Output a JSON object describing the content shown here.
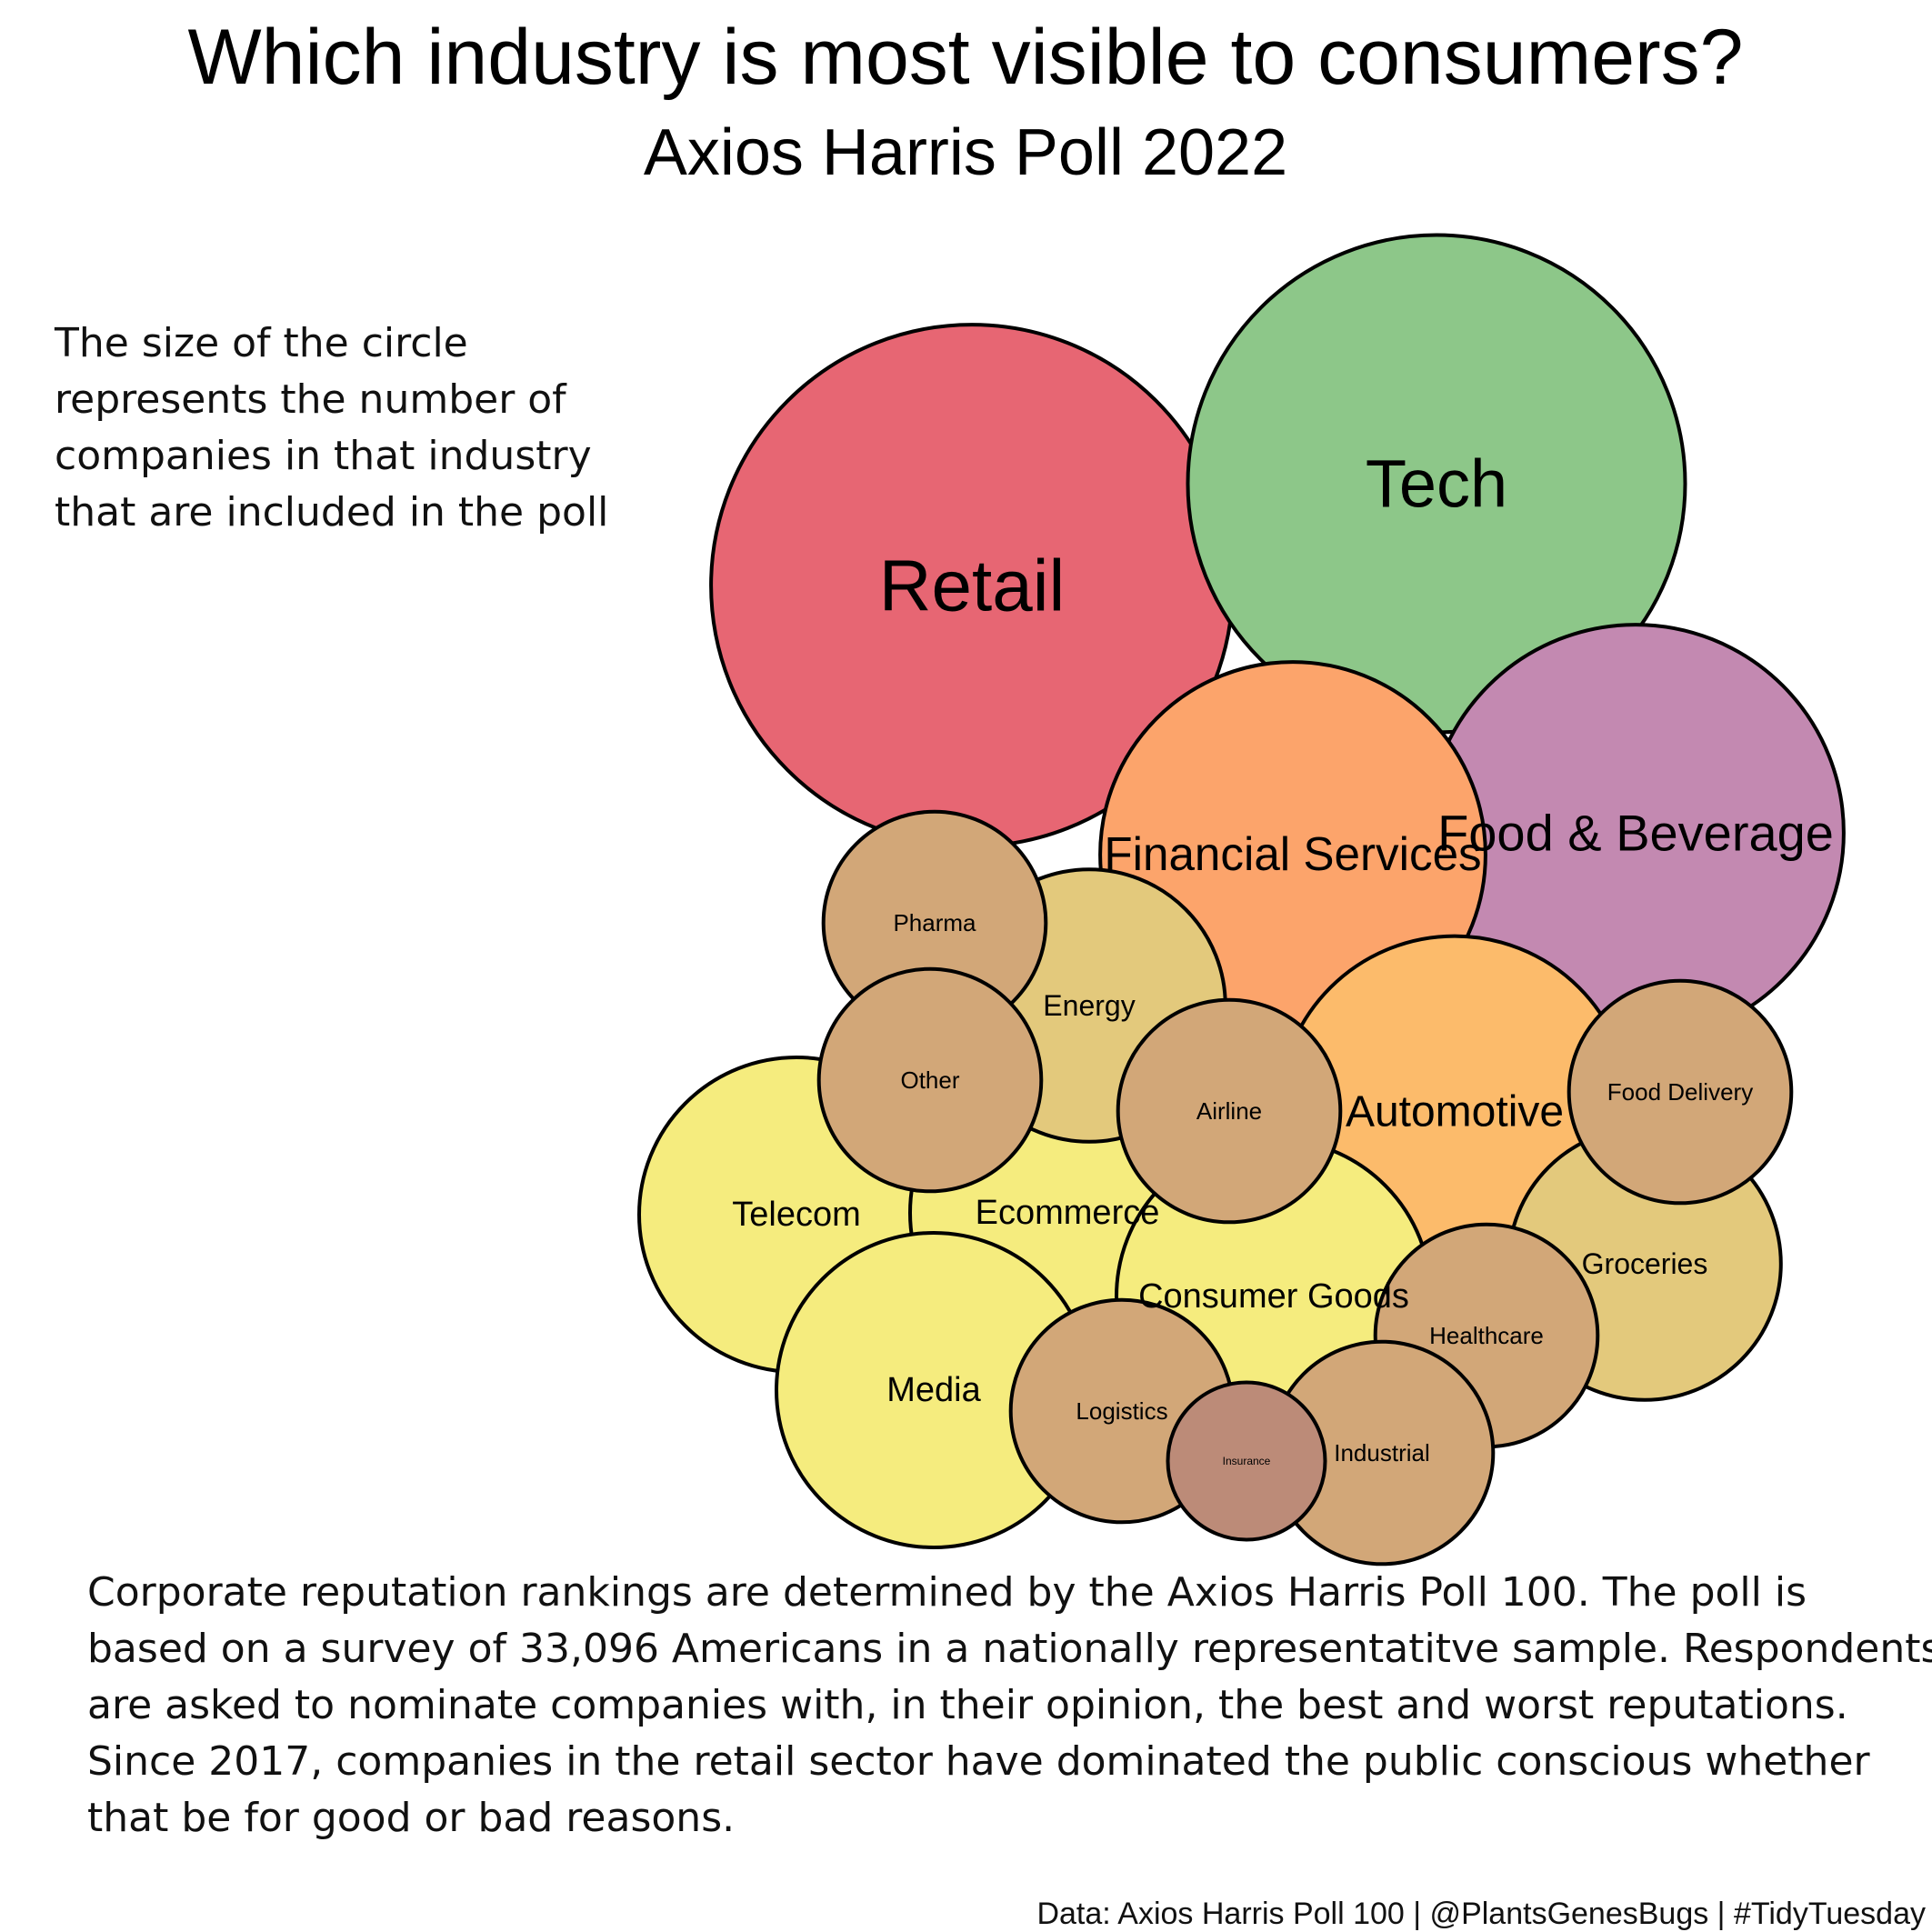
{
  "title": "Which industry is most visible to consumers?",
  "subtitle": "Axios Harris Poll 2022",
  "note_lines": [
    "The size of the circle",
    "represents the number of",
    "companies in that industry",
    "that are included in the poll"
  ],
  "description_lines": [
    "Corporate reputation rankings are determined by the Axios Harris Poll 100. The poll is",
    "based on a survey of 33,096 Americans in a nationally representatitve sample. Respondents",
    "are asked to nominate companies with, in their opinion, the best and worst reputations.",
    "Since 2017, companies in the retail sector have dominated the public conscious whether",
    "that be for good or bad reasons."
  ],
  "caption": "Data: Axios Harris Poll 100 | @PlantsGenesBugs | #TidyTuesday",
  "chart_data": {
    "type": "bubble",
    "value_meaning": "number of companies in that industry included in the poll (approximate, estimated from circle areas)",
    "palette": {
      "1": "#bc8b78",
      "2": "#d2a778",
      "3": "#e3c97c",
      "4": "#f5ec7e",
      "5": "#fcbb6b",
      "6": "#fca46b",
      "7": "#c389b1",
      "10": "#8dc789",
      "11": "#e76673"
    },
    "bubbles": [
      {
        "label": "Retail",
        "value": 11,
        "color": "#e76673"
      },
      {
        "label": "Tech",
        "value": 10,
        "color": "#8dc789"
      },
      {
        "label": "Food & Beverage",
        "value": 7,
        "color": "#c389b1"
      },
      {
        "label": "Financial Services",
        "value": 6,
        "color": "#fca46b"
      },
      {
        "label": "Automotive",
        "value": 5,
        "color": "#fcbb6b"
      },
      {
        "label": "Telecom",
        "value": 4,
        "color": "#f5ec7e"
      },
      {
        "label": "Ecommerce",
        "value": 4,
        "color": "#f5ec7e"
      },
      {
        "label": "Consumer Goods",
        "value": 4,
        "color": "#f5ec7e"
      },
      {
        "label": "Media",
        "value": 4,
        "color": "#f5ec7e"
      },
      {
        "label": "Energy",
        "value": 3,
        "color": "#e3c97c"
      },
      {
        "label": "Groceries",
        "value": 3,
        "color": "#e3c97c"
      },
      {
        "label": "Pharma",
        "value": 2,
        "color": "#d2a778"
      },
      {
        "label": "Other",
        "value": 2,
        "color": "#d2a778"
      },
      {
        "label": "Airline",
        "value": 2,
        "color": "#d2a778"
      },
      {
        "label": "Food Delivery",
        "value": 2,
        "color": "#d2a778"
      },
      {
        "label": "Healthcare",
        "value": 2,
        "color": "#d2a778"
      },
      {
        "label": "Logistics",
        "value": 2,
        "color": "#d2a778"
      },
      {
        "label": "Industrial",
        "value": 2,
        "color": "#d2a778"
      },
      {
        "label": "Insurance",
        "value": 1,
        "color": "#bc8b78"
      }
    ]
  }
}
